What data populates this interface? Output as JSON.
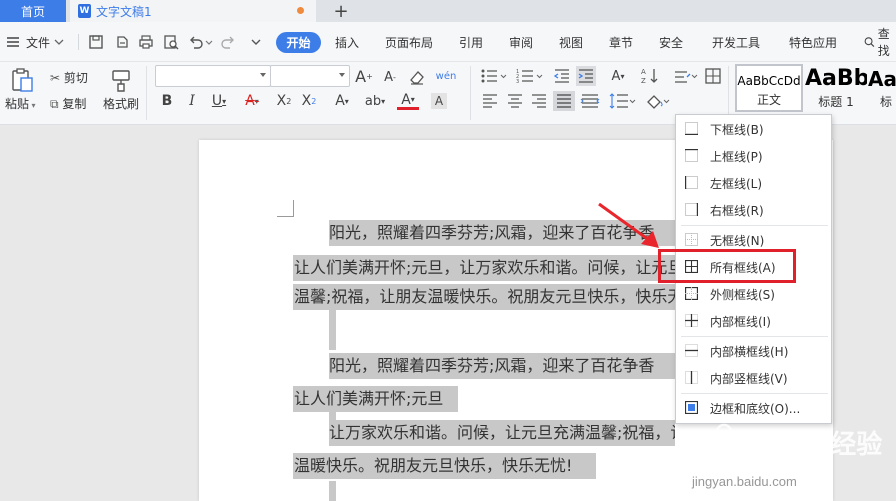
{
  "tabs": {
    "home": "首页",
    "doc": "文字文稿1",
    "doc_icon": "W",
    "add": "+"
  },
  "menubar": {
    "file": "文件",
    "items": [
      "开始",
      "插入",
      "页面布局",
      "引用",
      "审阅",
      "视图",
      "章节",
      "安全",
      "开发工具",
      "特色应用"
    ],
    "search": "查找"
  },
  "ribbon": {
    "paste": "粘贴",
    "cut": "剪切",
    "copy": "复制",
    "format_painter": "格式刷",
    "styles": [
      {
        "sample": "AaBbCcDd",
        "name": "正文"
      },
      {
        "sample": "AaBb",
        "name": "标题 1"
      },
      {
        "sample": "Aa",
        "name": "标"
      }
    ]
  },
  "document": {
    "lines": [
      "阳光，照耀着四季芬芳;风霜，迎来了百花争香",
      "让人们美满开怀;元旦，让万家欢乐和谐。问候，让元旦充",
      "温馨;祝福，让朋友温暖快乐。祝朋友元旦快乐，快乐无忧",
      "阳光，照耀着四季芬芳;风霜，迎来了百花争香",
      "让人们美满开怀;元旦",
      "让万家欢乐和谐。问候，让元旦充满温馨;祝福，让朋友",
      "温暖快乐。祝朋友元旦快乐，快乐无忧!"
    ]
  },
  "border_menu": {
    "items": [
      {
        "label": "下框线(B)",
        "icon": "bottom-border-icon"
      },
      {
        "label": "上框线(P)",
        "icon": "top-border-icon"
      },
      {
        "label": "左框线(L)",
        "icon": "left-border-icon"
      },
      {
        "label": "右框线(R)",
        "icon": "right-border-icon"
      },
      {
        "label": "无框线(N)",
        "icon": "no-border-icon"
      },
      {
        "label": "所有框线(A)",
        "icon": "all-borders-icon"
      },
      {
        "label": "外侧框线(S)",
        "icon": "outside-borders-icon"
      },
      {
        "label": "内部框线(I)",
        "icon": "inside-borders-icon"
      },
      {
        "label": "内部横框线(H)",
        "icon": "inside-horizontal-border-icon"
      },
      {
        "label": "内部竖框线(V)",
        "icon": "inside-vertical-border-icon"
      },
      {
        "label": "边框和底纹(O)...",
        "icon": "borders-shading-icon"
      }
    ],
    "highlighted": "所有框线(A)"
  },
  "colors": {
    "accent": "#3d7de8",
    "highlight_box": "#e0202a",
    "arrow": "#e8262c",
    "selection": "#c8c8c8"
  },
  "watermark": {
    "text": "Baidu经验",
    "url": "jingyan.baidu.com"
  }
}
